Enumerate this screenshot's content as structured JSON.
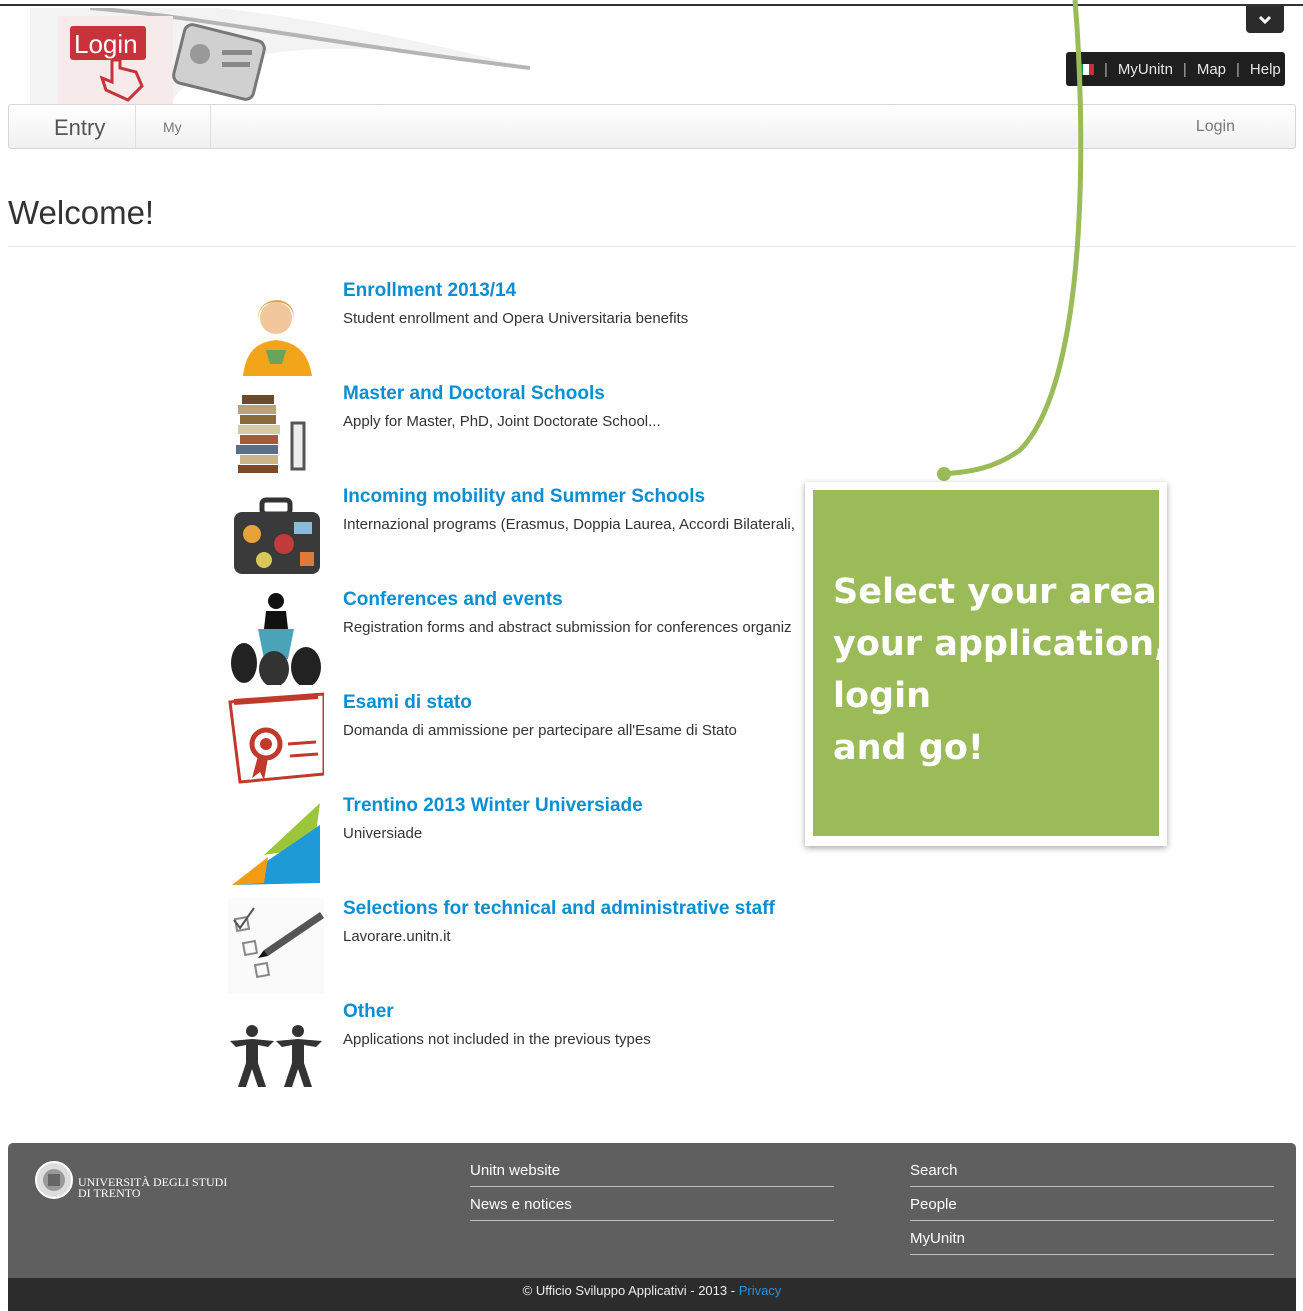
{
  "header": {
    "login_logo_text": "Login",
    "top_links": [
      "MyUnitn",
      "Map",
      "Help"
    ],
    "flag_colors": [
      "#009246",
      "#ffffff",
      "#ce2b37"
    ]
  },
  "navbar": {
    "brand": "Entry",
    "my": "My",
    "login": "Login"
  },
  "page": {
    "title": "Welcome!"
  },
  "apps": [
    {
      "title": "Enrollment 2013/14",
      "desc": "Student enrollment and Opera Universitaria benefits",
      "icon": "student-photo-icon"
    },
    {
      "title": "Master and Doctoral Schools",
      "desc": "Apply for Master, PhD, Joint Doctorate School...",
      "icon": "books-icon"
    },
    {
      "title": "Incoming mobility and Summer Schools",
      "desc": "Internazional programs (Erasmus, Doppia Laurea, Accordi Bilaterali,",
      "icon": "suitcase-icon"
    },
    {
      "title": "Conferences and events",
      "desc": "Registration forms and abstract submission for conferences organiz",
      "icon": "conference-speaker-icon"
    },
    {
      "title": "Esami di stato",
      "desc": "Domanda di ammissione per partecipare all'Esame di Stato",
      "icon": "certificate-icon"
    },
    {
      "title": "Trentino 2013 Winter Universiade",
      "desc": "Universiade",
      "icon": "universiade-logo-icon"
    },
    {
      "title": "Selections for technical and administrative staff",
      "desc": "Lavorare.unitn.it",
      "icon": "checklist-pen-icon"
    },
    {
      "title": "Other",
      "desc": "Applications not included in the previous types",
      "icon": "people-chain-icon"
    }
  ],
  "callout": {
    "lines": [
      "Select your area,",
      "your application,",
      "login",
      "and go!"
    ],
    "color": "#9bbb58"
  },
  "footer": {
    "university": [
      "UNIVERSITÀ DEGLI STUDI",
      "DI TRENTO"
    ],
    "col1": [
      "Unitn website",
      "News e notices"
    ],
    "col2": [
      "Search",
      "People",
      "MyUnitn"
    ],
    "copyright": "© Ufficio Sviluppo Applicativi - 2013 -",
    "privacy": "Privacy"
  }
}
